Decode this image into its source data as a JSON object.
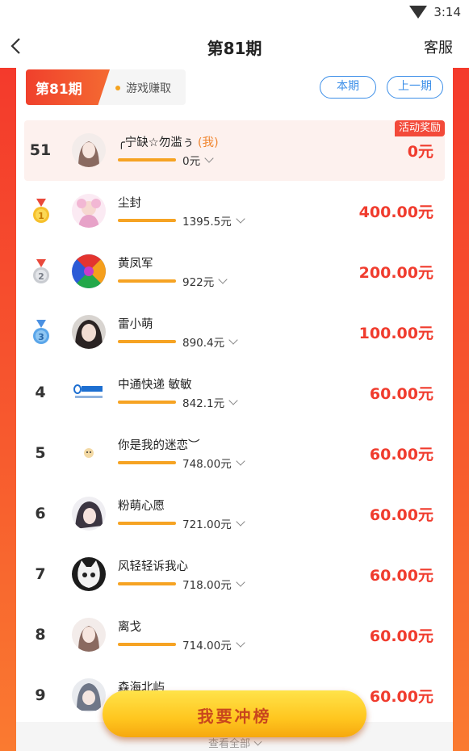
{
  "status_bar": {
    "time": "3:14"
  },
  "nav": {
    "title": "第81期",
    "service": "客服"
  },
  "period": {
    "tag": "第81期",
    "category": "游戏赚取"
  },
  "buttons": {
    "current": "本期",
    "previous": "上一期"
  },
  "my_row": {
    "rank": "51",
    "name": "╭宁缺☆勿滥ぅ",
    "me_tag": "(我)",
    "amount": "0元",
    "reward": "0元",
    "badge": "活动奖励"
  },
  "rows": [
    {
      "rank": "1",
      "name": "尘封",
      "amount": "1395.5元",
      "reward": "400.00元"
    },
    {
      "rank": "2",
      "name": "黄凤军",
      "amount": "922元",
      "reward": "200.00元"
    },
    {
      "rank": "3",
      "name": "雷小萌",
      "amount": "890.4元",
      "reward": "100.00元"
    },
    {
      "rank": "4",
      "name": "中通快递 敏敏",
      "amount": "842.1元",
      "reward": "60.00元"
    },
    {
      "rank": "5",
      "name": "你是我的迷恋︶",
      "amount": "748.00元",
      "reward": "60.00元"
    },
    {
      "rank": "6",
      "name": "粉萌心愿",
      "amount": "721.00元",
      "reward": "60.00元"
    },
    {
      "rank": "7",
      "name": "风轻轻诉我心",
      "amount": "718.00元",
      "reward": "60.00元"
    },
    {
      "rank": "8",
      "name": "离戈",
      "amount": "714.00元",
      "reward": "60.00元"
    },
    {
      "rank": "9",
      "name": "森海北屿",
      "amount": "",
      "reward": "60.00元"
    }
  ],
  "view_all": "查看全部",
  "cta": "我要冲榜",
  "colors": {
    "accent": "#f03c2e",
    "progress": "#f6a323",
    "link": "#3b8ee8",
    "cta": "#ffc61f"
  }
}
